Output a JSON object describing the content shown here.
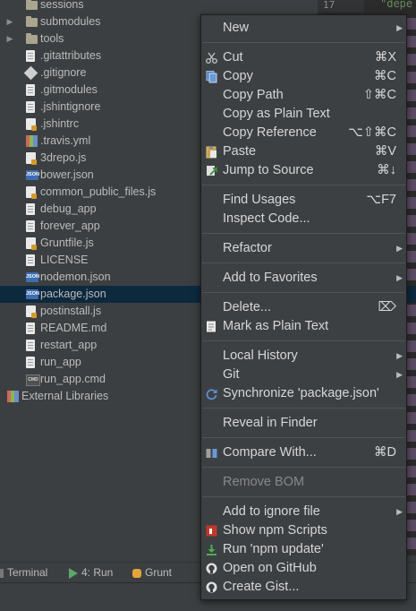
{
  "tree": {
    "items": [
      {
        "label": "sessions",
        "icon": "folder-icon",
        "name": "tree-item-sessions",
        "arrow": ""
      },
      {
        "label": "submodules",
        "icon": "folder-icon",
        "name": "tree-item-submodules",
        "arrow": "▶"
      },
      {
        "label": "tools",
        "icon": "folder-icon",
        "name": "tree-item-tools",
        "arrow": "▶"
      },
      {
        "label": ".gitattributes",
        "icon": "file-icon",
        "name": "tree-item-gitattributes",
        "arrow": ""
      },
      {
        "label": ".gitignore",
        "icon": "git-icon",
        "name": "tree-item-gitignore",
        "arrow": ""
      },
      {
        "label": ".gitmodules",
        "icon": "file-icon",
        "name": "tree-item-gitmodules",
        "arrow": ""
      },
      {
        "label": ".jshintignore",
        "icon": "file-icon",
        "name": "tree-item-jshintignore",
        "arrow": ""
      },
      {
        "label": ".jshintrc",
        "icon": "js-icon",
        "name": "tree-item-jshintrc",
        "arrow": ""
      },
      {
        "label": ".travis.yml",
        "icon": "yml-icon",
        "name": "tree-item-travis",
        "arrow": ""
      },
      {
        "label": "3drepo.js",
        "icon": "js-icon",
        "name": "tree-item-3drepo",
        "arrow": ""
      },
      {
        "label": "bower.json",
        "icon": "json-icon",
        "name": "tree-item-bower",
        "arrow": ""
      },
      {
        "label": "common_public_files.js",
        "icon": "js-icon",
        "name": "tree-item-common-public-files",
        "arrow": ""
      },
      {
        "label": "debug_app",
        "icon": "file-icon",
        "name": "tree-item-debug-app",
        "arrow": ""
      },
      {
        "label": "forever_app",
        "icon": "file-icon",
        "name": "tree-item-forever-app",
        "arrow": ""
      },
      {
        "label": "Gruntfile.js",
        "icon": "js-icon",
        "name": "tree-item-gruntfile",
        "arrow": ""
      },
      {
        "label": "LICENSE",
        "icon": "file-icon",
        "name": "tree-item-license",
        "arrow": ""
      },
      {
        "label": "nodemon.json",
        "icon": "json-icon",
        "name": "tree-item-nodemon",
        "arrow": ""
      },
      {
        "label": "package.json",
        "icon": "json-icon",
        "name": "tree-item-package",
        "arrow": "",
        "selected": true
      },
      {
        "label": "postinstall.js",
        "icon": "js-icon",
        "name": "tree-item-postinstall",
        "arrow": ""
      },
      {
        "label": "README.md",
        "icon": "md-icon",
        "name": "tree-item-readme",
        "arrow": ""
      },
      {
        "label": "restart_app",
        "icon": "file-icon",
        "name": "tree-item-restart-app",
        "arrow": ""
      },
      {
        "label": "run_app",
        "icon": "file-icon",
        "name": "tree-item-run-app",
        "arrow": ""
      },
      {
        "label": "run_app.cmd",
        "icon": "cmd-icon",
        "name": "tree-item-run-app-cmd",
        "arrow": ""
      },
      {
        "label": "External Libraries",
        "icon": "library-icon",
        "name": "tree-item-external-libraries",
        "arrow": ""
      }
    ]
  },
  "editor": {
    "line_number": "17",
    "text_fragment": "\"depe"
  },
  "toolbar": {
    "terminal_label": "Terminal",
    "run_label": "4: Run",
    "grunt_label": "Grunt"
  },
  "menu": {
    "items": [
      {
        "type": "item",
        "label": "New",
        "shortcut": "",
        "submenu": true,
        "icon": "",
        "name": "menu-new"
      },
      {
        "type": "sep"
      },
      {
        "type": "item",
        "label": "Cut",
        "shortcut": "⌘X",
        "icon": "scissors-icon",
        "name": "menu-cut"
      },
      {
        "type": "item",
        "label": "Copy",
        "shortcut": "⌘C",
        "icon": "copy-icon",
        "name": "menu-copy"
      },
      {
        "type": "item",
        "label": "Copy Path",
        "shortcut": "⇧⌘C",
        "icon": "",
        "name": "menu-copy-path"
      },
      {
        "type": "item",
        "label": "Copy as Plain Text",
        "shortcut": "",
        "icon": "",
        "name": "menu-copy-plain-text"
      },
      {
        "type": "item",
        "label": "Copy Reference",
        "shortcut": "⌥⇧⌘C",
        "icon": "",
        "name": "menu-copy-reference"
      },
      {
        "type": "item",
        "label": "Paste",
        "shortcut": "⌘V",
        "icon": "paste-icon",
        "name": "menu-paste"
      },
      {
        "type": "item",
        "label": "Jump to Source",
        "shortcut": "⌘↓",
        "icon": "jump-icon",
        "name": "menu-jump-to-source"
      },
      {
        "type": "sep"
      },
      {
        "type": "item",
        "label": "Find Usages",
        "shortcut": "⌥F7",
        "icon": "",
        "name": "menu-find-usages"
      },
      {
        "type": "item",
        "label": "Inspect Code...",
        "shortcut": "",
        "icon": "",
        "name": "menu-inspect-code"
      },
      {
        "type": "sep"
      },
      {
        "type": "item",
        "label": "Refactor",
        "shortcut": "",
        "submenu": true,
        "icon": "",
        "name": "menu-refactor"
      },
      {
        "type": "sep"
      },
      {
        "type": "item",
        "label": "Add to Favorites",
        "shortcut": "",
        "submenu": true,
        "icon": "",
        "name": "menu-add-to-favorites"
      },
      {
        "type": "sep"
      },
      {
        "type": "item",
        "label": "Delete...",
        "shortcut": "⌦",
        "icon": "",
        "name": "menu-delete"
      },
      {
        "type": "item",
        "label": "Mark as Plain Text",
        "shortcut": "",
        "icon": "plain-text-icon",
        "name": "menu-mark-plain-text"
      },
      {
        "type": "sep"
      },
      {
        "type": "item",
        "label": "Local History",
        "shortcut": "",
        "submenu": true,
        "icon": "",
        "name": "menu-local-history"
      },
      {
        "type": "item",
        "label": "Git",
        "shortcut": "",
        "submenu": true,
        "icon": "",
        "name": "menu-git"
      },
      {
        "type": "item",
        "label": "Synchronize 'package.json'",
        "shortcut": "",
        "icon": "sync-icon",
        "name": "menu-synchronize"
      },
      {
        "type": "sep"
      },
      {
        "type": "item",
        "label": "Reveal in Finder",
        "shortcut": "",
        "icon": "",
        "name": "menu-reveal-in-finder"
      },
      {
        "type": "sep"
      },
      {
        "type": "item",
        "label": "Compare With...",
        "shortcut": "⌘D",
        "icon": "compare-icon",
        "name": "menu-compare-with"
      },
      {
        "type": "sep"
      },
      {
        "type": "item",
        "label": "Remove BOM",
        "shortcut": "",
        "icon": "",
        "disabled": true,
        "name": "menu-remove-bom"
      },
      {
        "type": "sep"
      },
      {
        "type": "item",
        "label": "Add to ignore file",
        "shortcut": "",
        "submenu": true,
        "icon": "",
        "name": "menu-add-to-ignore"
      },
      {
        "type": "item",
        "label": "Show npm Scripts",
        "shortcut": "",
        "icon": "npm-icon",
        "name": "menu-show-npm-scripts"
      },
      {
        "type": "item",
        "label": "Run 'npm update'",
        "shortcut": "",
        "icon": "download-icon",
        "name": "menu-run-npm-update"
      },
      {
        "type": "item",
        "label": "Open on GitHub",
        "shortcut": "",
        "icon": "github-icon",
        "name": "menu-open-on-github"
      },
      {
        "type": "item",
        "label": "Create Gist...",
        "shortcut": "",
        "icon": "github-icon",
        "name": "menu-create-gist"
      }
    ]
  },
  "colors": {
    "background": "#3c3f41",
    "selection": "#0d293e",
    "menu_background": "#3d4043",
    "menu_text": "#d6d6d6",
    "disabled_text": "#888888",
    "icon_blue": "#3d6eb0"
  }
}
